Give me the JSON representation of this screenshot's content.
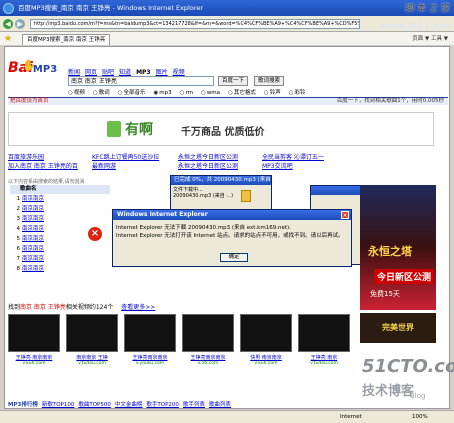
{
  "window": {
    "title": "百度MP3搜索_南京 南京 王铮亮 - Windows Internet Explorer"
  },
  "watermark": {
    "site_cn": "脚 本 之 家",
    "site_url": "www.Jb51.net",
    "big": "51CTO.com",
    "sub": "技术博客",
    "blog": "Blog"
  },
  "address": {
    "url": "http://mp3.baidu.com/m?f=ms&tn=baidump3&ct=134217728&lf=&rn=&word=%C4%CF%BE%A9+%C4%CF%BE%A9+%CD%F5%EE"
  },
  "favbar": {
    "tab": "百度MP3搜索_南京 南京 王铮亮",
    "tools": "页面 ▼  工具 ▼"
  },
  "logo": {
    "bai": "Bai",
    "mp3": "MP3"
  },
  "nav": {
    "tabs": [
      "新闻",
      "网页",
      "贴吧",
      "知道",
      "MP3",
      "图片",
      "视频"
    ]
  },
  "search": {
    "query": "南京 南京 王铮亮",
    "btn1": "百度一下",
    "btn2": "歌词搜索"
  },
  "radios": [
    "视频",
    "歌词",
    "全部音乐",
    "mp3",
    "rm",
    "wma",
    "其它格式",
    "铃声",
    "彩铃"
  ],
  "resultbar": {
    "left": "把百度设为首页",
    "right": "百度一下，找到相关歌曲1个，用时0.005秒"
  },
  "ad": {
    "logo": "有啊",
    "slogan": "千万商品 优质低价"
  },
  "links": {
    "l1": "百度旅游乐园",
    "l2": "KFC跳上订餐再50送沙拉",
    "l3": "永恒之塔今日新区公测",
    "l4": "全民当剪客 沁谭订五一",
    "l5": "加入南京 南京 王铮亮的百",
    "l6": "最新网游",
    "l7": "永恒之塔今日新区公测",
    "l8": "MP3交流吧",
    "notice": "以下内容系由搜索的结果,请勿混淆"
  },
  "table": {
    "header": "歌曲名",
    "rows": [
      {
        "n": "1",
        "s": "南京南京"
      },
      {
        "n": "2",
        "s": "南京南京"
      },
      {
        "n": "3",
        "s": "南京南京"
      },
      {
        "n": "4",
        "s": "南京南京"
      },
      {
        "n": "5",
        "s": "南京南京"
      },
      {
        "n": "6",
        "s": "南京南京"
      },
      {
        "n": "7",
        "s": "南京南京"
      },
      {
        "n": "8",
        "s": "南京南京"
      }
    ]
  },
  "dlg1": {
    "title": "已完成 0%，共 20090430.mp3 (来自 ...",
    "line1": "文件下载中...",
    "line2": "20090430.mp3 (来自 ...)"
  },
  "dlg2": {
    "title": "Windows Internet Explorer",
    "line1": "Internet Explorer 无法下载 20090430.mp3 (来自 ext.km169.net).",
    "line2": "Internet Explorer 无法打开该 Internet 站点。请求的站点不可用，或找不到。请以后再试。",
    "ok": "确定"
  },
  "sidead": {
    "t1": "永恒之塔",
    "t2": "今日新区公测",
    "t3": "免费15天",
    "t4": "完美世界"
  },
  "video": {
    "title_pre": "找到",
    "query": "南京 南京 王铮亮",
    "title_post": "相关视频约124个",
    "more": "查看更多>>"
  },
  "thumbs": [
    {
      "cap": "王铮亮 南京南京",
      "url": "v.ku6.com"
    },
    {
      "cap": "南京南京 王铮",
      "url": "v.tudou.com"
    },
    {
      "cap": "王铮亮南京南京",
      "url": "v.youku.com"
    },
    {
      "cap": "王铮亮南京南京",
      "url": "v.56.com"
    },
    {
      "cap": "快男 南京南京",
      "url": "v.ku6.com"
    },
    {
      "cap": "王铮亮 南京",
      "url": "v.tudou.com"
    }
  ],
  "hot": {
    "title": "MP3排行榜",
    "items": [
      "新歌TOP100",
      "歌曲TOP500",
      "中文金曲榜",
      "歌手TOP200",
      "歌手列表",
      "歌曲列表"
    ]
  },
  "status": {
    "text": "",
    "internet": "Internet",
    "zoom": "100%"
  }
}
